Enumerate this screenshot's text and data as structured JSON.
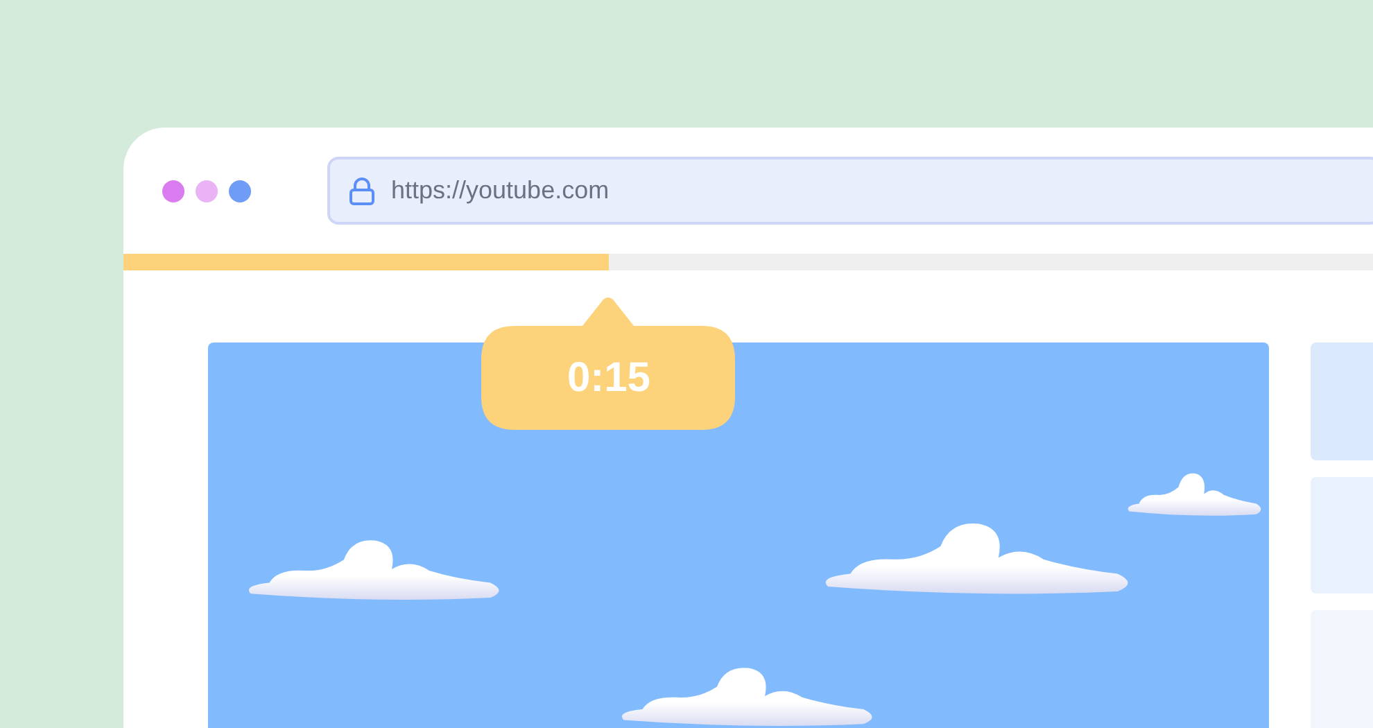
{
  "browser": {
    "address": "https://youtube.com"
  },
  "progress": {
    "level": 0.38
  },
  "time_tooltip": {
    "text": "0:15"
  }
}
